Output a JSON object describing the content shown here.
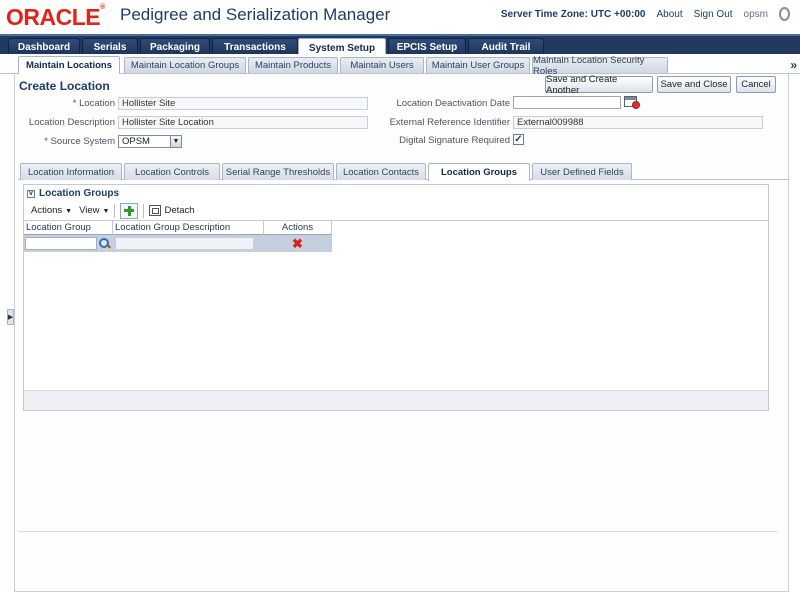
{
  "header": {
    "logo_text": "ORACLE",
    "logo_mark": "®",
    "app_title": "Pedigree and Serialization Manager",
    "server_time": "Server Time Zone: UTC +00:00",
    "about": "About",
    "sign_out": "Sign Out",
    "user": "opsm"
  },
  "main_tabs": [
    {
      "label": "Dashboard"
    },
    {
      "label": "Serials"
    },
    {
      "label": "Packaging"
    },
    {
      "label": "Transactions"
    },
    {
      "label": "System Setup"
    },
    {
      "label": "EPCIS Setup"
    },
    {
      "label": "Audit Trail"
    }
  ],
  "sub_tabs": [
    {
      "label": "Maintain Locations"
    },
    {
      "label": "Maintain Location Groups"
    },
    {
      "label": "Maintain Products"
    },
    {
      "label": "Maintain Users"
    },
    {
      "label": "Maintain User Groups"
    },
    {
      "label": "Maintain Location Security Roles"
    }
  ],
  "more_glyph": "»",
  "page_title": "Create Location",
  "buttons": {
    "save_create_another": "Save and Create Another",
    "save_close": "Save and Close",
    "cancel": "Cancel"
  },
  "form": {
    "location_label": "* Location",
    "location_value": "Hollister Site",
    "description_label": "Location Description",
    "description_value": "Hollister Site Location",
    "source_label": "* Source System",
    "source_value": "OPSM",
    "deactivation_label": "Location Deactivation Date",
    "deactivation_value": "",
    "external_label": "External Reference Identifier",
    "external_value": "External009988",
    "digital_label": "Digital Signature Required",
    "digital_checked": "✓"
  },
  "detail_tabs": [
    {
      "label": "Location Information"
    },
    {
      "label": "Location Controls"
    },
    {
      "label": "Serial Range Thresholds"
    },
    {
      "label": "Location Contacts"
    },
    {
      "label": "Location Groups"
    },
    {
      "label": "User Defined Fields"
    }
  ],
  "panel": {
    "title": "Location Groups",
    "collapse_glyph": "v",
    "actions_menu": "Actions",
    "view_menu": "View",
    "detach": "Detach",
    "caret": "▼",
    "columns": [
      "Location Group",
      "Location Group Description",
      "Actions"
    ],
    "delete_glyph": "✖"
  },
  "left_handle_glyph": "▶",
  "colors": {
    "brand_red": "#e2231a",
    "nav_dark": "#23395f",
    "title_blue": "#1f3c67",
    "selected_row": "#c6cfe0"
  }
}
